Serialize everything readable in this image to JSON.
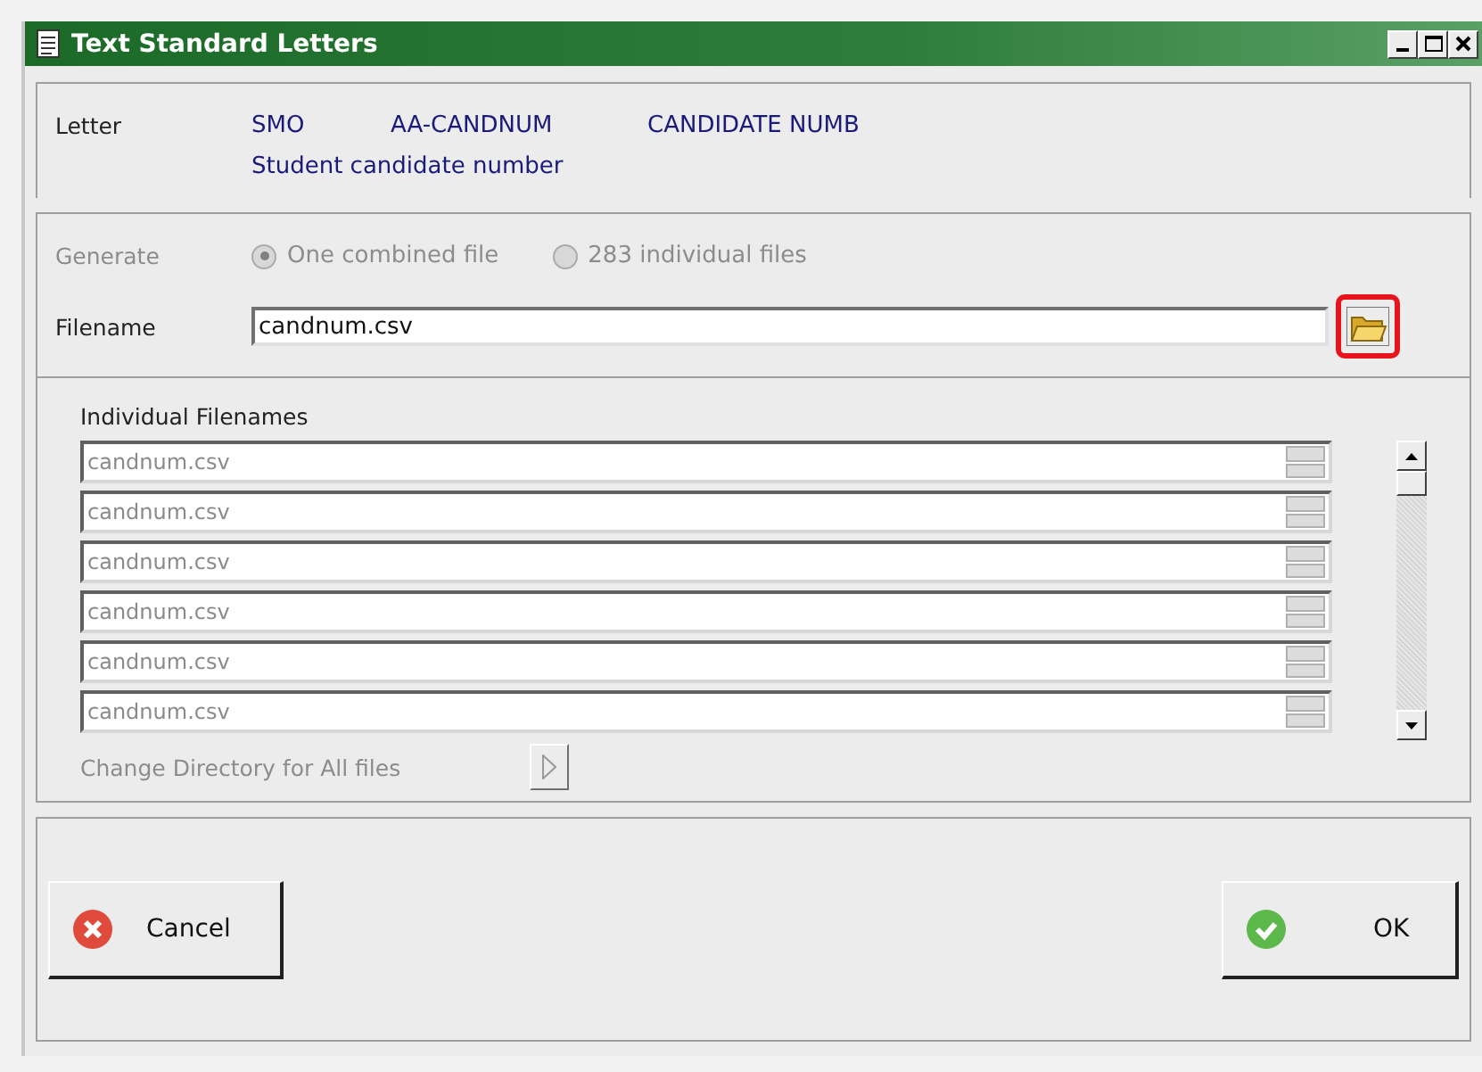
{
  "window": {
    "title": "Text Standard Letters"
  },
  "letter": {
    "label": "Letter",
    "code": "SMO",
    "id": "AA-CANDNUM",
    "name": "CANDIDATE NUMB",
    "description": "Student candidate number"
  },
  "generate": {
    "label": "Generate",
    "disabled": true,
    "options": [
      {
        "label": "One combined file",
        "selected": true
      },
      {
        "label": "283 individual files",
        "selected": false
      }
    ]
  },
  "filename": {
    "label": "Filename",
    "value": "candnum.csv",
    "browse_highlighted": true
  },
  "individual": {
    "title": "Individual Filenames",
    "disabled": true,
    "rows": [
      {
        "value": "candnum.csv"
      },
      {
        "value": "candnum.csv"
      },
      {
        "value": "candnum.csv"
      },
      {
        "value": "candnum.csv"
      },
      {
        "value": "candnum.csv"
      },
      {
        "value": "candnum.csv"
      }
    ],
    "change_dir_label": "Change Directory for All files"
  },
  "buttons": [
    {
      "kind": "cancel",
      "label": "Cancel"
    },
    {
      "kind": "ok",
      "label": "OK"
    }
  ]
}
